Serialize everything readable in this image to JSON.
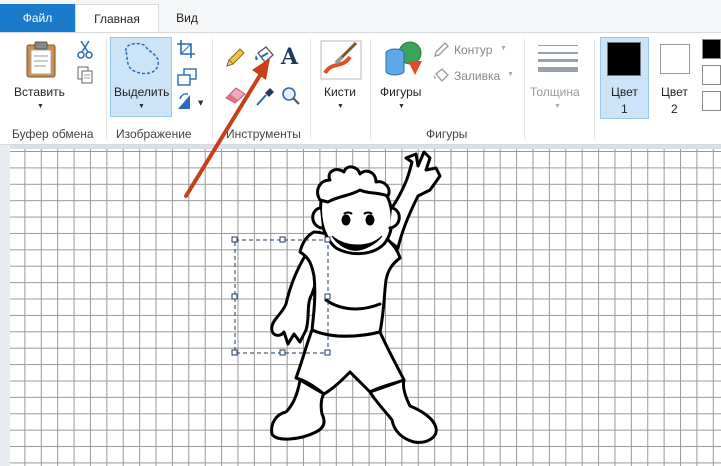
{
  "tabs": {
    "file": "Файл",
    "home": "Главная",
    "view": "Вид"
  },
  "clipboard": {
    "paste": "Вставить",
    "group": "Буфер обмена"
  },
  "image": {
    "select": "Выделить",
    "group": "Изображение"
  },
  "tools": {
    "group": "Инструменты"
  },
  "brushes": {
    "label": "Кисти"
  },
  "shapes": {
    "label": "Фигуры",
    "outline": "Контур",
    "fill": "Заливка",
    "group": "Фигуры"
  },
  "size": {
    "label": "Толщина"
  },
  "colors": {
    "color1_line1": "Цвет",
    "color1_line2": "1",
    "color2_line1": "Цвет",
    "color2_line2": "2",
    "color1_value": "#000000",
    "color2_value": "#ffffff"
  },
  "accent": "#1979ca",
  "annotation_arrow_color": "#c8401a"
}
